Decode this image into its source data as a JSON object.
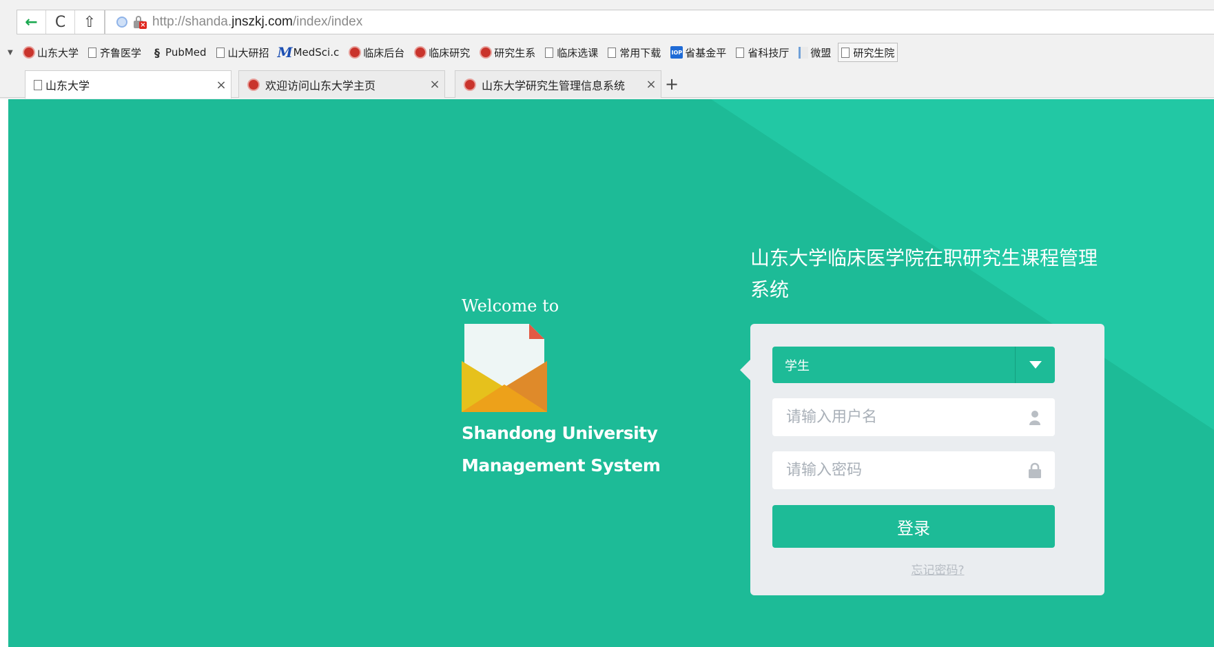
{
  "browser": {
    "address": {
      "scheme_prefix": "http://shanda.",
      "host": "jnszkj.com",
      "path": "/index/index"
    },
    "nav": {
      "back_glyph": "←",
      "reload_glyph": "C",
      "home_glyph": "⇧"
    },
    "bookmarks": [
      {
        "label": "山东大学",
        "icon": "university-seal-icon"
      },
      {
        "label": "齐鲁医学",
        "icon": "page-icon"
      },
      {
        "label": "PubMed",
        "icon": "dna-icon"
      },
      {
        "label": "山大研招",
        "icon": "page-icon"
      },
      {
        "label": "MedSci.c",
        "icon": "medsci-m-icon"
      },
      {
        "label": "临床后台",
        "icon": "university-seal-icon"
      },
      {
        "label": "临床研究",
        "icon": "red-seal-icon"
      },
      {
        "label": "研究生系",
        "icon": "university-seal-icon"
      },
      {
        "label": "临床选课",
        "icon": "page-icon"
      },
      {
        "label": "常用下载",
        "icon": "page-icon"
      },
      {
        "label": "省基金平",
        "icon": "iop-icon"
      },
      {
        "label": "省科技厅",
        "icon": "page-icon"
      },
      {
        "label": "微盟",
        "icon": "document-icon"
      },
      {
        "label": "研究生院",
        "icon": "page-icon"
      }
    ],
    "tabs": [
      {
        "label": "山东大学",
        "active": true,
        "icon": "page-icon"
      },
      {
        "label": "欢迎访问山东大学主页",
        "active": false,
        "icon": "university-seal-icon"
      },
      {
        "label": "山东大学研究生管理信息系统",
        "active": false,
        "icon": "university-seal-icon"
      }
    ],
    "tab_close_glyph": "×",
    "new_tab_glyph": "+"
  },
  "page": {
    "welcome": "Welcome to",
    "brand_line1": "Shandong University",
    "brand_line2": "Management System",
    "system_title": "山东大学临床医学院在职研究生课程管理系统",
    "logo_icon": "envelope-icon",
    "login": {
      "role_selected": "学生",
      "username_placeholder": "请输入用户名",
      "password_placeholder": "请输入密码",
      "submit_label": "登录",
      "forgot_label": "忘记密码?"
    }
  },
  "colors": {
    "page_bg": "#1dbb97",
    "page_bg_light": "#22c8a4",
    "card_bg": "#eaedf0",
    "primary_button": "#1dbb97",
    "placeholder_text": "#a9b0b8"
  }
}
